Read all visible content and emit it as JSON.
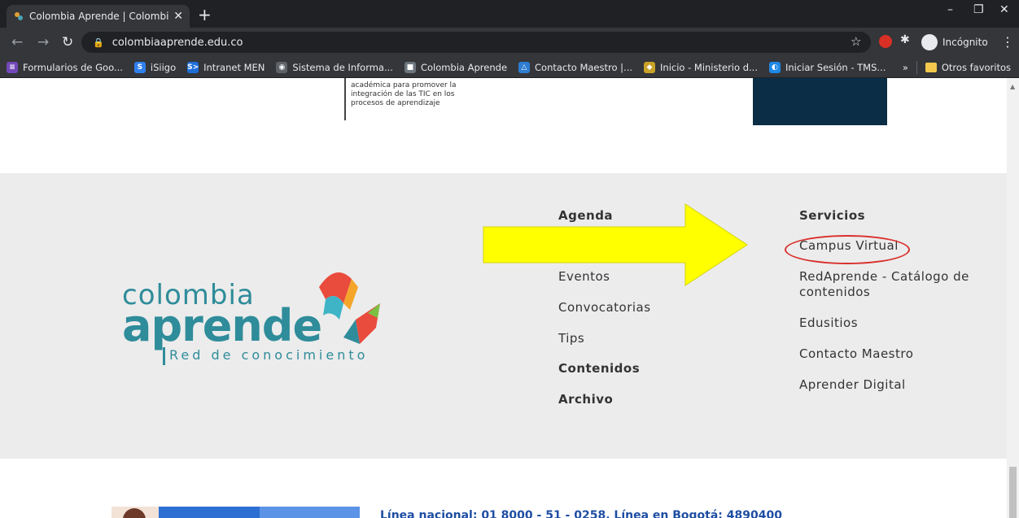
{
  "browser": {
    "tab_title": "Colombia Aprende | Colombia Ap",
    "tab_close": "✕",
    "new_tab": "+",
    "window_controls": {
      "minimize": "–",
      "restore": "❐",
      "close": "✕"
    },
    "url": "colombiaaprende.edu.co",
    "incognito_label": "Incógnito",
    "bookmarks": [
      {
        "label": "Formularios de Goo...",
        "icon": "forms-icon",
        "color": "#7248b9",
        "glyph": "≡"
      },
      {
        "label": "iSiigo",
        "icon": "siigo-icon",
        "color": "#2f80ed",
        "glyph": "S"
      },
      {
        "label": "Intranet MEN",
        "icon": "intranet-icon",
        "color": "#1e6fd9",
        "glyph": "S>"
      },
      {
        "label": "Sistema de Informa...",
        "icon": "globe-icon",
        "color": "#5f6368",
        "glyph": "◉"
      },
      {
        "label": "Colombia Aprende",
        "icon": "colombia-aprende-icon",
        "color": "#6c757d",
        "glyph": "■"
      },
      {
        "label": "Contacto Maestro |...",
        "icon": "contacto-icon",
        "color": "#2d7dd2",
        "glyph": "△"
      },
      {
        "label": "Inicio - Ministerio d...",
        "icon": "ministerio-icon",
        "color": "#c9a227",
        "glyph": "◆"
      },
      {
        "label": "Iniciar Sesión - TMS...",
        "icon": "tms-icon",
        "color": "#1e88e5",
        "glyph": "◐"
      }
    ],
    "bookmarks_overflow": "»",
    "other_favorites": "Otros favoritos"
  },
  "page": {
    "prev_card_text": "académica para promover la integración de las TIC en los procesos de aprendizaje",
    "logo": {
      "line1": "colombia",
      "line2": "aprende",
      "tagline": "Red de conocimiento"
    },
    "footer_col1": [
      {
        "label": "Agenda",
        "bold": true
      },
      {
        "label": "Eventos",
        "bold": false
      },
      {
        "label": "Convocatorias",
        "bold": false
      },
      {
        "label": "Tips",
        "bold": false
      },
      {
        "label": "Contenidos",
        "bold": true
      },
      {
        "label": "Archivo",
        "bold": true
      }
    ],
    "footer_col2": [
      {
        "label": "Servicios",
        "bold": true
      },
      {
        "label": "Campus Virtual",
        "bold": false
      },
      {
        "label": "RedAprende - Catálogo de contenidos",
        "bold": false
      },
      {
        "label": "Edusitios",
        "bold": false
      },
      {
        "label": "Contacto Maestro",
        "bold": false
      },
      {
        "label": "Aprender Digital",
        "bold": false
      }
    ],
    "contact_line": "Línea nacional: 01 8000 - 51 - 0258, Línea en Bogotá: 4890400"
  },
  "colors": {
    "brand_teal": "#2f8c9a",
    "arrow_yellow": "#ffff00",
    "highlight_red": "#d9302c",
    "footer_bg": "#ececec"
  }
}
